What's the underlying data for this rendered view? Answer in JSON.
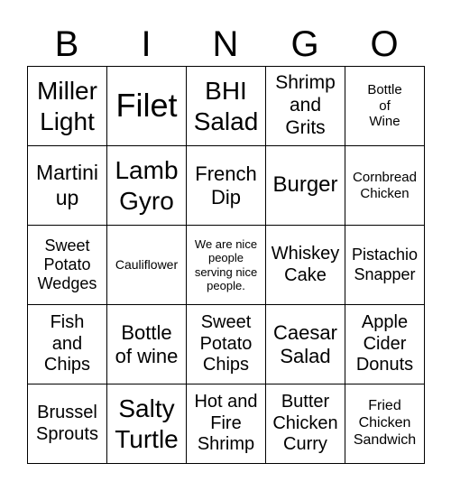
{
  "header": {
    "letters": [
      "B",
      "I",
      "N",
      "G",
      "O"
    ]
  },
  "cells": [
    [
      "Miller\nLight",
      "Filet",
      "BHI\nSalad",
      "Shrimp\nand\nGrits",
      "Bottle\nof\nWine"
    ],
    [
      "Martini\nup",
      "Lamb\nGyro",
      "French\nDip",
      "Burger",
      "Cornbread\nChicken"
    ],
    [
      "Sweet\nPotato\nWedges",
      "Cauliflower",
      "We are nice\npeople\nserving nice\npeople.",
      "Whiskey\nCake",
      "Pistachio\nSnapper"
    ],
    [
      "Fish\nand\nChips",
      "Bottle\nof wine",
      "Sweet\nPotato\nChips",
      "Caesar\nSalad",
      "Apple\nCider\nDonuts"
    ],
    [
      "Brussel\nSprouts",
      "Salty\nTurtle",
      "Hot and\nFire\nShrimp",
      "Butter\nChicken\nCurry",
      "Fried\nChicken\nSandwich"
    ]
  ]
}
